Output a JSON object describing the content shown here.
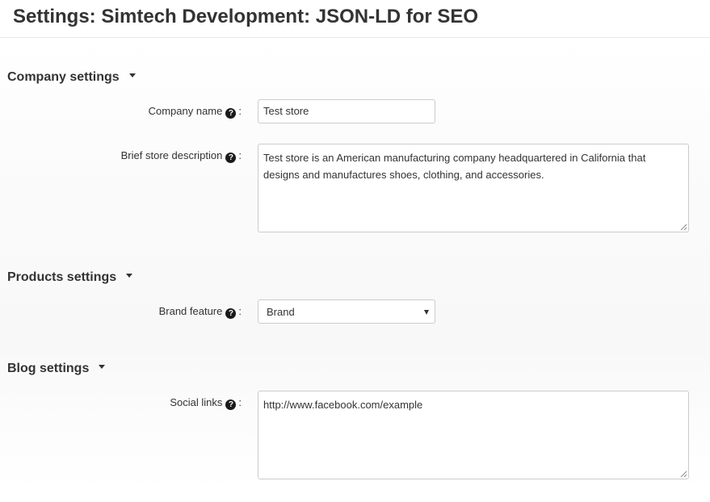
{
  "header": {
    "title": "Settings: Simtech Development: JSON-LD for SEO"
  },
  "sections": {
    "company": {
      "title": "Company settings",
      "company_name": {
        "label": "Company name",
        "value": "Test store"
      },
      "brief_description": {
        "label": "Brief store description",
        "value": "Test store is an American manufacturing company headquartered in California that designs and manufactures shoes, clothing, and accessories."
      }
    },
    "products": {
      "title": "Products settings",
      "brand_feature": {
        "label": "Brand feature",
        "selected": "Brand"
      }
    },
    "blog": {
      "title": "Blog settings",
      "social_links": {
        "label": "Social links",
        "value": "http://www.facebook.com/example"
      }
    }
  },
  "icons": {
    "help": "question-circle-icon",
    "caret": "caret-down-icon",
    "select_arrow": "chevron-down-icon"
  },
  "colors": {
    "text": "#333333",
    "border": "#cccccc",
    "help_icon": "#1a1a1a"
  }
}
